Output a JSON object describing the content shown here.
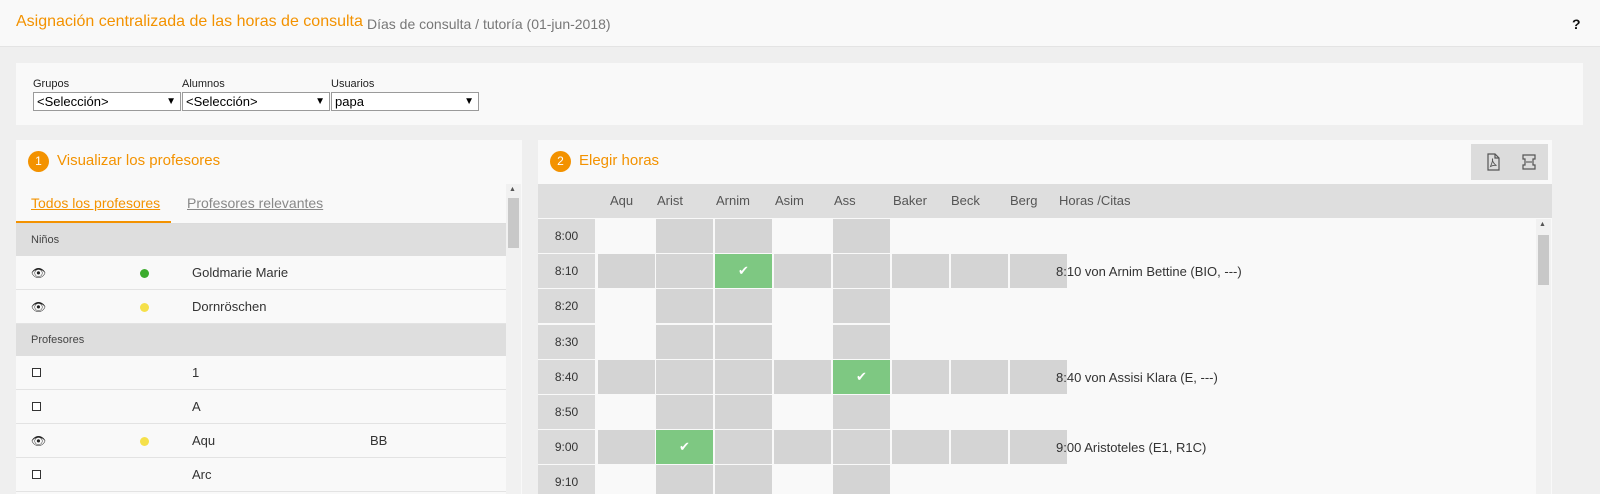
{
  "header": {
    "title": "Asignación centralizada de las horas de consulta",
    "subtitle": "Días de consulta / tutoría (01-jun-2018)",
    "help": "?"
  },
  "filters": [
    {
      "label": "Grupos",
      "value": "<Selección>"
    },
    {
      "label": "Alumnos",
      "value": "<Selección>"
    },
    {
      "label": "Usuarios",
      "value": "papa"
    }
  ],
  "left_panel": {
    "step": "1",
    "title": "Visualizar los profesores",
    "tabs": [
      "Todos los profesores",
      "Profesores relevantes"
    ],
    "groups": [
      {
        "label": "Niños",
        "rows": [
          {
            "icon": "eye-icon",
            "status": "green",
            "name": "Goldmarie Marie",
            "code": ""
          },
          {
            "icon": "eye-icon",
            "status": "yellow",
            "name": "Dornröschen",
            "code": ""
          }
        ]
      },
      {
        "label": "Profesores",
        "rows": [
          {
            "icon": "checkbox",
            "status": "",
            "name": "1",
            "code": ""
          },
          {
            "icon": "checkbox",
            "status": "",
            "name": "A",
            "code": ""
          },
          {
            "icon": "eye-icon",
            "status": "yellow",
            "name": "Aqu",
            "code": "BB"
          },
          {
            "icon": "checkbox",
            "status": "",
            "name": "Arc",
            "code": ""
          }
        ]
      }
    ]
  },
  "right_panel": {
    "step": "2",
    "title": "Elegir horas",
    "toolbar": [
      "pdf-icon",
      "print-icon"
    ],
    "columns": [
      "Aqu",
      "Arist",
      "Arnim",
      "Asim",
      "Ass",
      "Baker",
      "Beck",
      "Berg"
    ],
    "appointments_header": "Horas /Citas",
    "rows": [
      {
        "time": "8:00",
        "cells": [
          "",
          "busy",
          "busy",
          "",
          "busy",
          "",
          "",
          ""
        ],
        "appointment": ""
      },
      {
        "time": "8:10",
        "cells": [
          "busy",
          "busy",
          "booked",
          "busy",
          "busy",
          "busy",
          "busy",
          "busy"
        ],
        "appointment": "8:10 von Arnim Bettine (BIO, ---)"
      },
      {
        "time": "8:20",
        "cells": [
          "",
          "busy",
          "busy",
          "",
          "busy",
          "",
          "",
          ""
        ],
        "appointment": ""
      },
      {
        "time": "8:30",
        "cells": [
          "",
          "busy",
          "busy",
          "",
          "busy",
          "",
          "",
          ""
        ],
        "appointment": ""
      },
      {
        "time": "8:40",
        "cells": [
          "busy",
          "busy",
          "busy",
          "busy",
          "booked",
          "busy",
          "busy",
          "busy"
        ],
        "appointment": "8:40 von Assisi Klara (E, ---)"
      },
      {
        "time": "8:50",
        "cells": [
          "",
          "busy",
          "busy",
          "",
          "busy",
          "",
          "",
          ""
        ],
        "appointment": ""
      },
      {
        "time": "9:00",
        "cells": [
          "busy",
          "booked",
          "busy",
          "busy",
          "busy",
          "busy",
          "busy",
          "busy"
        ],
        "appointment": "9:00 Aristoteles (E1, R1C)"
      },
      {
        "time": "9:10",
        "cells": [
          "",
          "busy",
          "busy",
          "",
          "busy",
          "",
          "",
          ""
        ],
        "appointment": ""
      }
    ]
  },
  "colors": {
    "accent": "#f39200",
    "booked": "#7ec882",
    "busy": "#d4d4d4",
    "status_green": "#3cab2e",
    "status_yellow": "#f5e04a"
  }
}
